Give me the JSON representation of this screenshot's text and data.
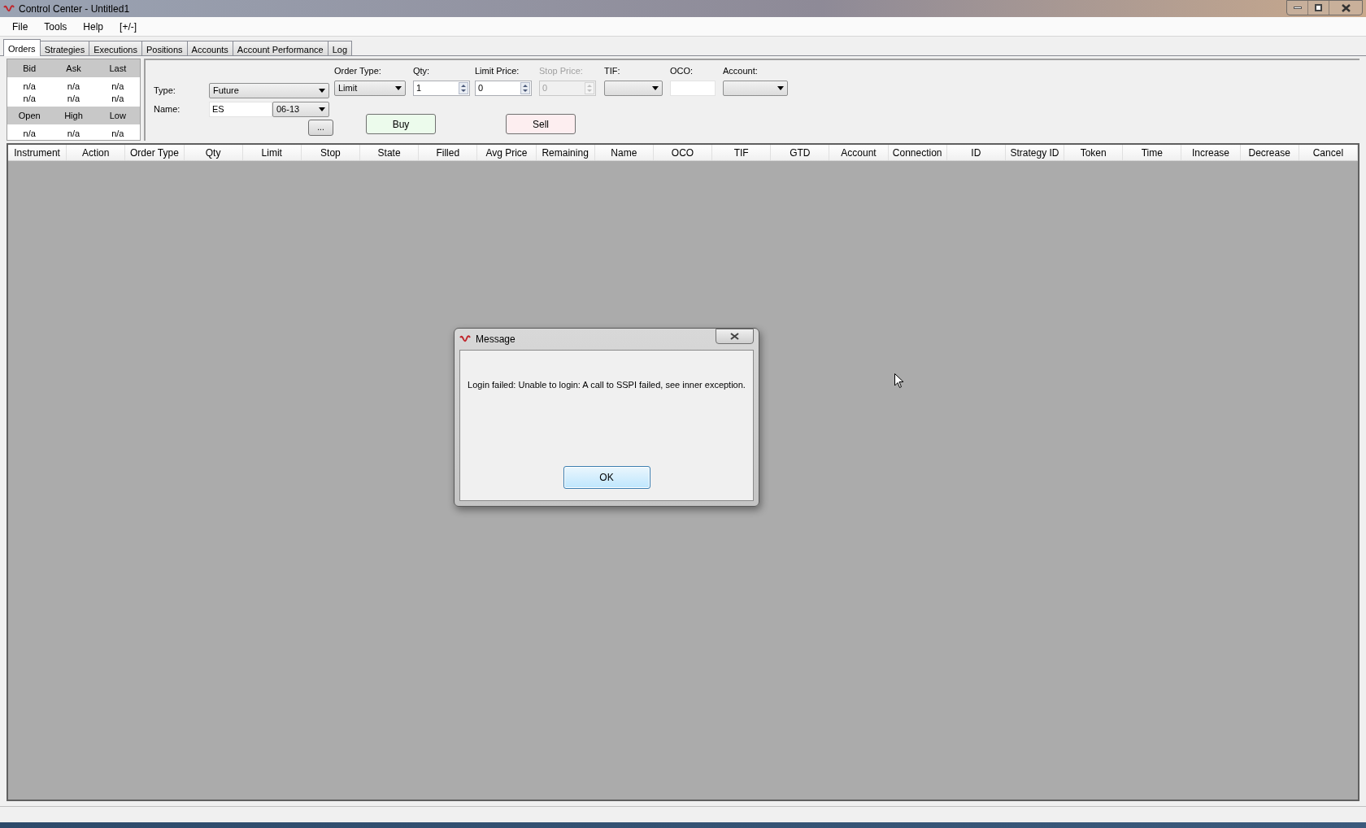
{
  "window": {
    "title": "Control Center - Untitled1"
  },
  "menu": [
    "File",
    "Tools",
    "Help",
    "[+/-]"
  ],
  "tabs": [
    {
      "label": "Orders",
      "selected": true
    },
    {
      "label": "Strategies",
      "selected": false
    },
    {
      "label": "Executions",
      "selected": false
    },
    {
      "label": "Positions",
      "selected": false
    },
    {
      "label": "Accounts",
      "selected": false
    },
    {
      "label": "Account Performance",
      "selected": false
    },
    {
      "label": "Log",
      "selected": false
    }
  ],
  "quote_panel": {
    "groups": [
      {
        "headers": [
          "Bid",
          "Ask",
          "Last"
        ],
        "rows": [
          [
            "n/a",
            "n/a",
            "n/a"
          ],
          [
            "n/a",
            "n/a",
            "n/a"
          ]
        ]
      },
      {
        "headers": [
          "Open",
          "High",
          "Low"
        ],
        "rows": [
          [
            "n/a",
            "n/a",
            "n/a"
          ]
        ]
      }
    ]
  },
  "order_form": {
    "type": {
      "label": "Type:",
      "value": "Future"
    },
    "name": {
      "label": "Name:",
      "value": "ES",
      "expiry": "06-13"
    },
    "browse_button": "...",
    "fields": [
      {
        "kind": "select",
        "label": "Order Type:",
        "value": "Limit",
        "disabled": false
      },
      {
        "kind": "spinner",
        "label": "Qty:",
        "value": "1",
        "disabled": false
      },
      {
        "kind": "spinner",
        "label": "Limit Price:",
        "value": "0",
        "disabled": false
      },
      {
        "kind": "spinner",
        "label": "Stop Price:",
        "value": "0",
        "disabled": true
      },
      {
        "kind": "select",
        "label": "TIF:",
        "disabled": false
      },
      {
        "kind": "text",
        "label": "OCO:",
        "disabled": false
      },
      {
        "kind": "select",
        "label": "Account:",
        "disabled": false
      }
    ],
    "buy_button": "Buy",
    "sell_button": "Sell"
  },
  "orders_table": {
    "columns": [
      "Instrument",
      "Action",
      "Order Type",
      "Qty",
      "Limit",
      "Stop",
      "State",
      "Filled",
      "Avg Price",
      "Remaining",
      "Name",
      "OCO",
      "TIF",
      "GTD",
      "Account",
      "Connection",
      "ID",
      "Strategy ID",
      "Token",
      "Time",
      "Increase",
      "Decrease",
      "Cancel"
    ]
  },
  "dialog": {
    "title": "Message",
    "message": "Login failed: Unable to login: A call to SSPI failed, see inner exception.",
    "ok_button": "OK"
  }
}
